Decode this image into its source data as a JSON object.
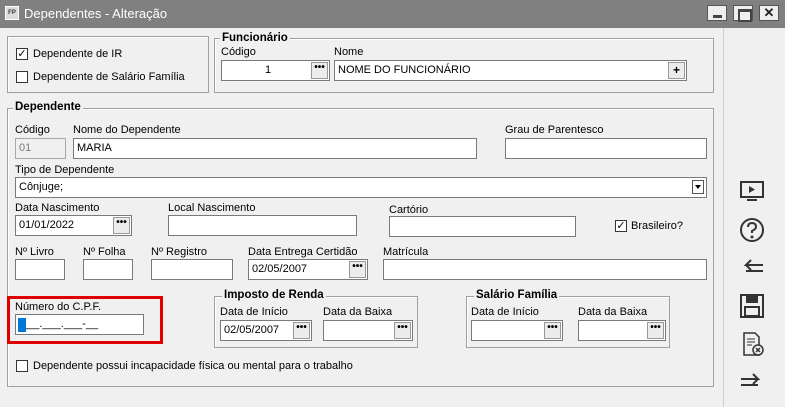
{
  "window": {
    "app_icon_text": "FP",
    "title": "Dependentes - Alteração",
    "close_glyph": "✕"
  },
  "flags": {
    "dependente_ir": "Dependente de IR",
    "dependente_ir_checked": true,
    "dependente_salario_familia": "Dependente de Salário Família",
    "dependente_salario_familia_checked": false
  },
  "funcionario": {
    "legend": "Funcionário",
    "codigo_label": "Código",
    "codigo_value": "1",
    "nome_label": "Nome",
    "nome_value": "NOME DO FUNCIONÁRIO"
  },
  "dependente": {
    "legend": "Dependente",
    "codigo_label": "Código",
    "codigo_value": "01",
    "nome_label": "Nome do Dependente",
    "nome_value": "MARIA",
    "grau_label": "Grau de Parentesco",
    "grau_value": "",
    "tipo_label": "Tipo de Dependente",
    "tipo_value": "Cônjuge;",
    "data_nasc_label": "Data Nascimento",
    "data_nasc_value": "01/01/2022",
    "local_nasc_label": "Local Nascimento",
    "local_nasc_value": "",
    "cartorio_label": "Cartório",
    "cartorio_value": "",
    "brasileiro_label": "Brasileiro?",
    "brasileiro_checked": true,
    "livro_label": "Nº Livro",
    "livro_value": "",
    "folha_label": "Nº Folha",
    "folha_value": "",
    "registro_label": "Nº Registro",
    "registro_value": "",
    "entrega_label": "Data Entrega Certidão",
    "entrega_value": "02/05/2007",
    "matricula_label": "Matrícula",
    "matricula_value": "",
    "cpf_label": "Número do C.P.F.",
    "cpf_value": "___.___.___-__",
    "incapacidade_label": "Dependente possui incapacidade física ou mental para o trabalho",
    "incapacidade_checked": false
  },
  "imposto_renda": {
    "legend": "Imposto de Renda",
    "inicio_label": "Data de Início",
    "inicio_value": "02/05/2007",
    "baixa_label": "Data da Baixa",
    "baixa_value": ""
  },
  "salario_familia": {
    "legend": "Salário Família",
    "inicio_label": "Data de Início",
    "inicio_value": "",
    "baixa_label": "Data da Baixa",
    "baixa_value": ""
  },
  "common": {
    "dots": "•••",
    "plus": "+",
    "check": "✓"
  },
  "sidebar": {
    "icons": [
      "monitor-icon",
      "help-icon",
      "back-arrow-icon",
      "save-icon",
      "delete-document-icon",
      "forward-arrow-icon"
    ]
  }
}
